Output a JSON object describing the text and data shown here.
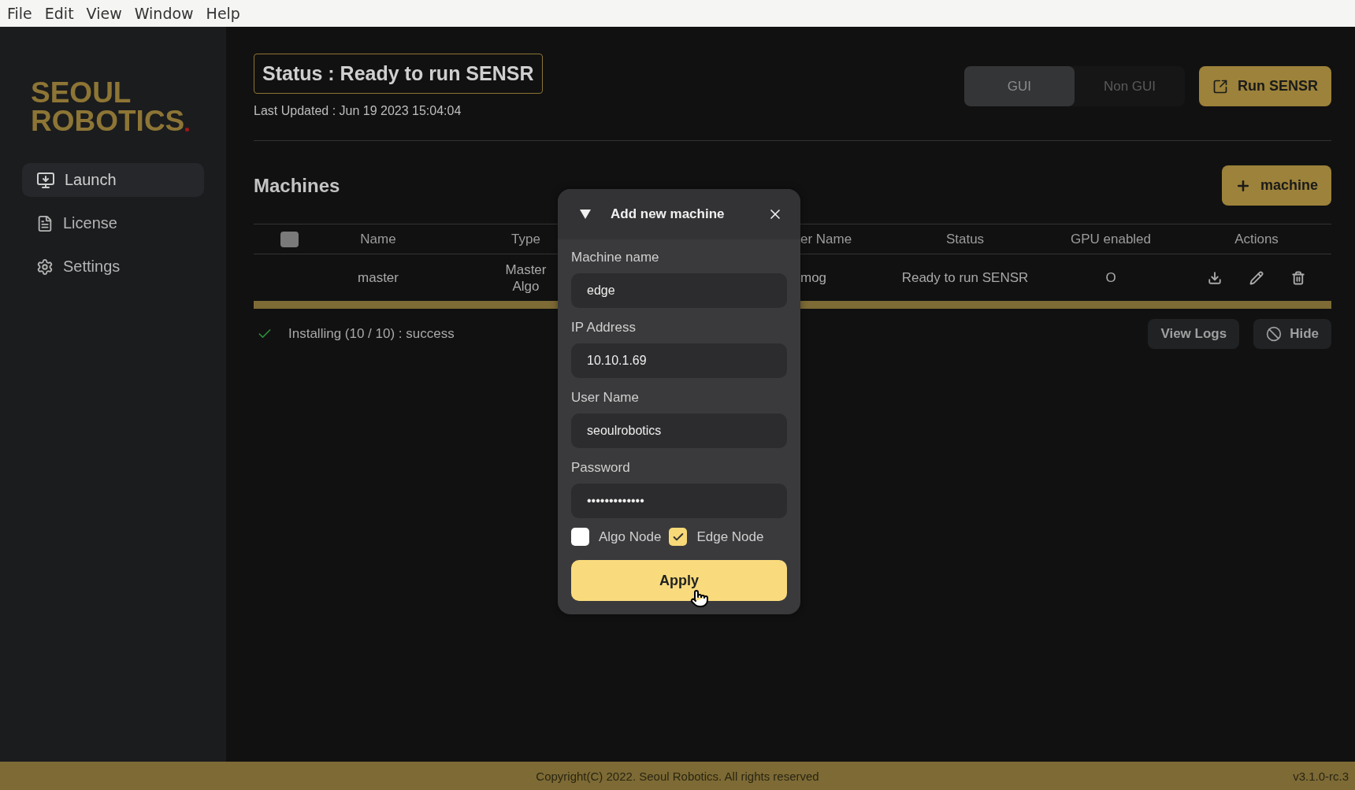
{
  "menubar": [
    "File",
    "Edit",
    "View",
    "Window",
    "Help"
  ],
  "logo": {
    "line_1": "SEOUL",
    "line_2": "ROBOTICS"
  },
  "sidebar": {
    "items": [
      {
        "label": "Launch",
        "selected": true,
        "kind": "launch"
      },
      {
        "label": "License",
        "selected": false,
        "kind": "license"
      },
      {
        "label": "Settings",
        "selected": false,
        "kind": "settings"
      }
    ]
  },
  "header": {
    "status": "Status : Ready to run SENSR",
    "last_updated": "Last Updated : Jun 19 2023 15:04:04",
    "mode_toggle": [
      {
        "label": "GUI",
        "selected": true
      },
      {
        "label": "Non GUI",
        "selected": false
      }
    ],
    "run_button": "Run SENSR"
  },
  "machines": {
    "title": "Machines",
    "add_button": "machine",
    "table": {
      "select_all": {
        "checked": false
      },
      "columns": [
        "Name",
        "Type",
        "er Name",
        "Status",
        "GPU enabled",
        "Actions"
      ],
      "rows": [
        {
          "name": "master",
          "type": [
            "Master",
            "Algo"
          ],
          "user_name": "mog",
          "status": "Ready to run SENSR",
          "gpu_enabled": "O"
        }
      ]
    },
    "progress": {
      "level": 1
    },
    "install_status": "Installing (10 / 10) : success",
    "buttons": [
      {
        "label": "View Logs",
        "kind": "logs"
      },
      {
        "label": "Hide",
        "kind": "hide"
      }
    ]
  },
  "dialog": {
    "title": "Add new machine",
    "fields": [
      {
        "label": "Machine name",
        "value": "edge"
      },
      {
        "label": "IP Address",
        "value": "10.10.1.69"
      },
      {
        "label": "User Name",
        "value": "seoulrobotics"
      },
      {
        "label": "Password",
        "value": "•••••••••••••"
      }
    ],
    "checkboxes": [
      {
        "label": "Algo Node",
        "checked": false
      },
      {
        "label": "Edge Node",
        "checked": true
      }
    ],
    "apply": "Apply"
  },
  "footer": {
    "copyright": "Copyright(C) 2022. Seoul Robotics. All rights reserved",
    "version": "v3.1.0-rc.3"
  }
}
